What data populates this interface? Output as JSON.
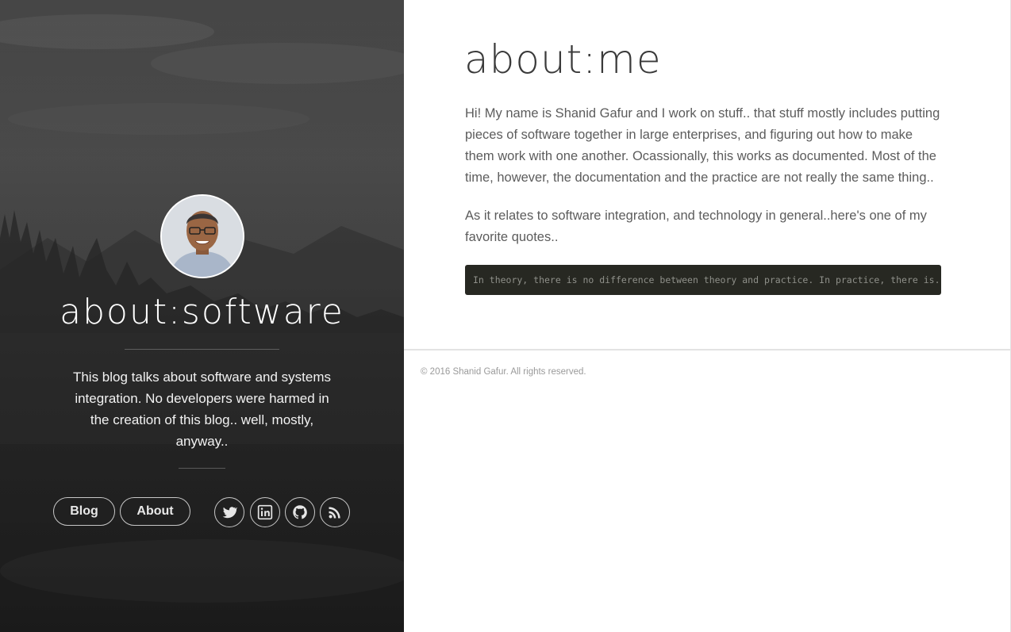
{
  "sidebar": {
    "site_title": "about:software",
    "description": "This blog talks about software and systems integration. No developers were harmed in the creation of this blog.. well, mostly, anyway..",
    "nav": [
      {
        "label": "Blog"
      },
      {
        "label": "About"
      }
    ],
    "social": [
      {
        "icon": "twitter-icon"
      },
      {
        "icon": "linkedin-icon"
      },
      {
        "icon": "github-icon"
      },
      {
        "icon": "rss-icon"
      }
    ]
  },
  "main": {
    "title": "about:me",
    "paragraphs": [
      "Hi! My name is Shanid Gafur and I work on stuff.. that stuff mostly includes putting pieces of software together in large enterprises, and figuring out how to make them work with one another. Ocassionally, this works as documented. Most of the time, however, the documentation and the practice are not really the same thing..",
      "As it relates to software integration, and technology in general..here's one of my favorite quotes.."
    ],
    "quote": "In theory, there is no difference between theory and practice. In practice, there is.."
  },
  "footer": {
    "copyright": "© 2016 Shanid Gafur. All rights reserved."
  },
  "colors": {
    "sidebar_bg": "#3a3a3a",
    "code_bg": "#272822",
    "text": "#5c5c5c",
    "title": "#3a3a3a"
  }
}
